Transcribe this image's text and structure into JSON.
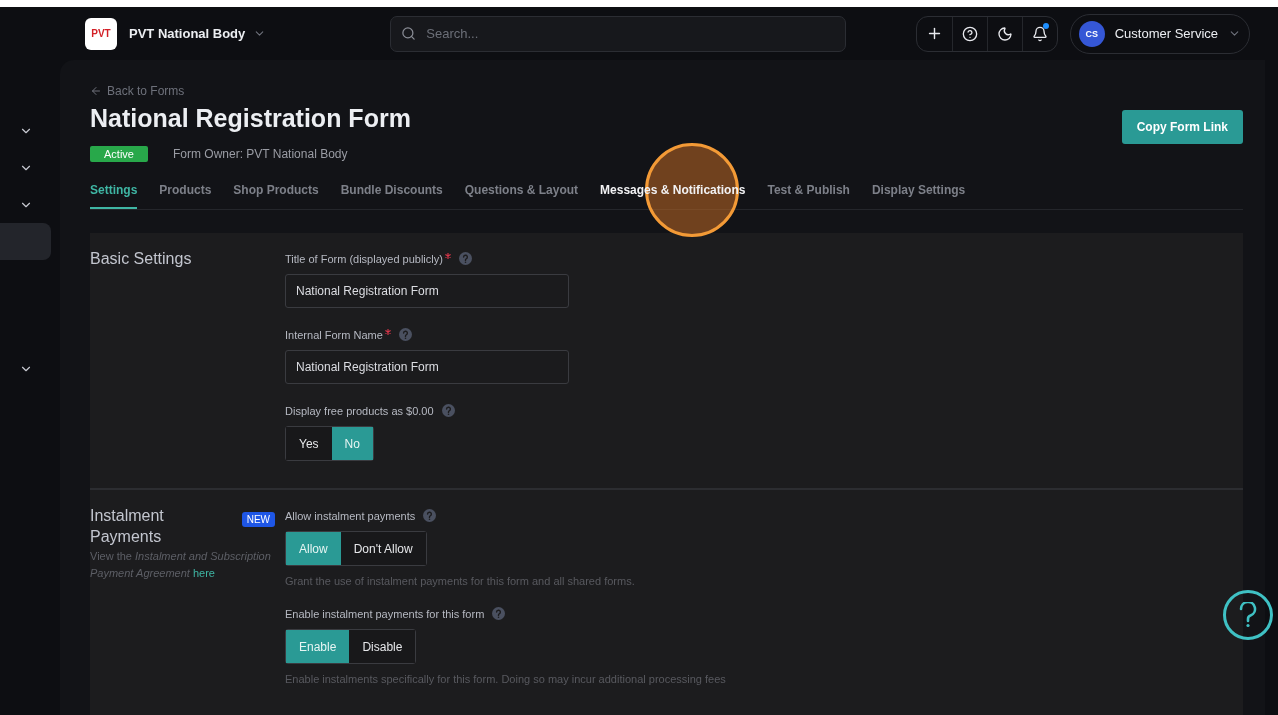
{
  "topbar": {
    "logo": "PVT",
    "org": "PVT National Body",
    "search": {
      "placeholder": "Search..."
    },
    "notifications_unread": true,
    "user": {
      "initials": "CS",
      "name": "Customer Service"
    }
  },
  "sidebar": {
    "items": [
      {
        "kind": "chevron",
        "selected": false
      },
      {
        "kind": "chevron",
        "selected": false
      },
      {
        "kind": "chevron",
        "selected": false
      },
      {
        "kind": "blank",
        "selected": true
      },
      {
        "kind": "chevron",
        "selected": false
      }
    ]
  },
  "header": {
    "back": "Back to Forms",
    "title": "National Registration Form",
    "status": "Active",
    "owner": "Form Owner: PVT National Body",
    "action": "Copy Form Link"
  },
  "tabs": [
    {
      "label": "Settings",
      "selected": true
    },
    {
      "label": "Products",
      "selected": false
    },
    {
      "label": "Shop Products",
      "selected": false
    },
    {
      "label": "Bundle Discounts",
      "selected": false
    },
    {
      "label": "Questions & Layout",
      "selected": false
    },
    {
      "label": "Messages & Notifications",
      "selected": false,
      "highlighted": true
    },
    {
      "label": "Test & Publish",
      "selected": false
    },
    {
      "label": "Display Settings",
      "selected": false
    }
  ],
  "sections": [
    {
      "title": "Basic Settings",
      "fields": [
        {
          "kind": "text",
          "label": "Title of Form (displayed publicly)",
          "required": true,
          "value": "National Registration Form"
        },
        {
          "kind": "text",
          "label": "Internal Form Name",
          "required": true,
          "value": "National Registration Form"
        },
        {
          "kind": "toggle",
          "label": "Display free products as $0.00",
          "required": false,
          "options": [
            {
              "label": "Yes",
              "selected": false
            },
            {
              "label": "No",
              "selected": true
            }
          ]
        }
      ]
    },
    {
      "title": "Instalment Payments",
      "badge": "NEW",
      "description": {
        "text": "View the *Instalment and Subscription Payment Agreement*",
        "link": "here"
      },
      "fields": [
        {
          "kind": "toggle",
          "label": "Allow instalment payments",
          "required": false,
          "options": [
            {
              "label": "Allow",
              "selected": true
            },
            {
              "label": "Don't Allow",
              "selected": false
            }
          ],
          "hint": "Grant the use of instalment payments for this form and all shared forms."
        },
        {
          "kind": "toggle",
          "label": "Enable instalment payments for this form",
          "required": false,
          "options": [
            {
              "label": "Enable",
              "selected": true
            },
            {
              "label": "Disable",
              "selected": false
            }
          ],
          "hint": "Enable instalments specifically for this form. Doing so may incur additional processing fees"
        }
      ]
    }
  ]
}
